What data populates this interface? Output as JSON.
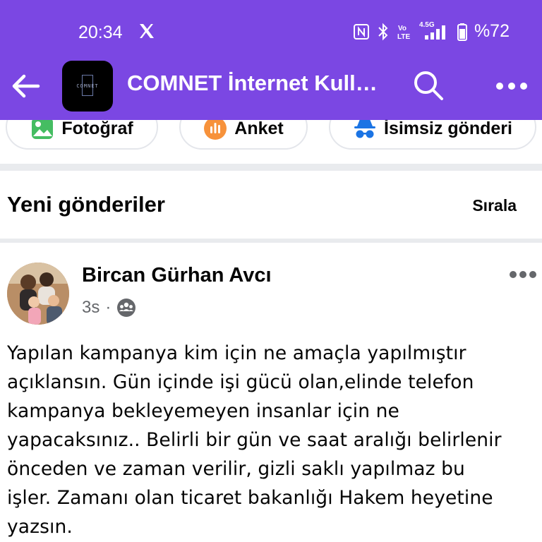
{
  "status_bar": {
    "time": "20:34",
    "network_label": "4.5G",
    "battery": "%72",
    "icons": [
      "x-logo-icon",
      "nfc-icon",
      "bluetooth-icon",
      "volte-icon",
      "signal-icon",
      "battery-icon"
    ]
  },
  "header": {
    "group_name": "COMNET İnternet Kull…",
    "logo_text": "COMNET",
    "icons": [
      "back-arrow-icon",
      "search-icon",
      "more-icon"
    ]
  },
  "composer_actions": [
    {
      "label": "Fotoğraf",
      "icon": "photo-icon"
    },
    {
      "label": "Anket",
      "icon": "poll-icon"
    },
    {
      "label": "İsimsiz gönderi",
      "icon": "anonymous-icon"
    }
  ],
  "feed": {
    "section_title": "Yeni gönderiler",
    "sort_label": "Sırala"
  },
  "post": {
    "author": "Bircan Gürhan Avcı",
    "time": "3s",
    "separator": "·",
    "audience_icon": "group-audience-icon",
    "lines": [
      "Yapılan kampanya kim için ne amaçla yapılmıştır",
      "açıklansın. Gün içinde işi gücü olan,elinde telefon",
      "kampanya bekleyemeyen insanlar için ne",
      "yapacaksınız.. Belirli bir gün ve saat aralığı belirlenir",
      "önceden ve zaman verilir, gizli saklı yapılmaz bu",
      "işler. Zamanı olan ticaret bakanlığı  Hakem heyetine",
      "yazsın."
    ]
  },
  "colors": {
    "header_bg": "#7b47e3",
    "text_primary": "#050505",
    "text_secondary": "#65676b",
    "divider": "#e9ebee",
    "photo_icon": "#45bd62",
    "poll_icon": "#f7923b",
    "anon_icon": "#1b74e4"
  }
}
